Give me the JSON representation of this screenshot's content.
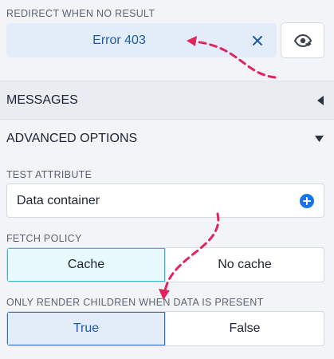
{
  "redirect": {
    "label": "REDIRECT WHEN NO RESULT",
    "value": "Error 403",
    "clear_glyph": "×"
  },
  "sections": {
    "messages": "MESSAGES",
    "advanced": "ADVANCED OPTIONS"
  },
  "test_attribute": {
    "label": "TEST ATTRIBUTE",
    "value": "Data container"
  },
  "fetch_policy": {
    "label": "FETCH POLICY",
    "options": [
      "Cache",
      "No cache"
    ],
    "selected": "Cache"
  },
  "render_children": {
    "label": "ONLY RENDER CHILDREN WHEN DATA IS PRESENT",
    "options": [
      "True",
      "False"
    ],
    "selected": "True"
  },
  "colors": {
    "accent_blue": "#1a73e8",
    "annotation": "#e0245e",
    "cache_selected": "#e8f9fb",
    "true_selected": "#e3edf9"
  },
  "icons": {
    "clear": "close-icon",
    "visibility": "eye-icon",
    "collapse_messages": "triangle-left-icon",
    "collapse_advanced": "triangle-down-icon",
    "add": "plus-circle-icon"
  }
}
